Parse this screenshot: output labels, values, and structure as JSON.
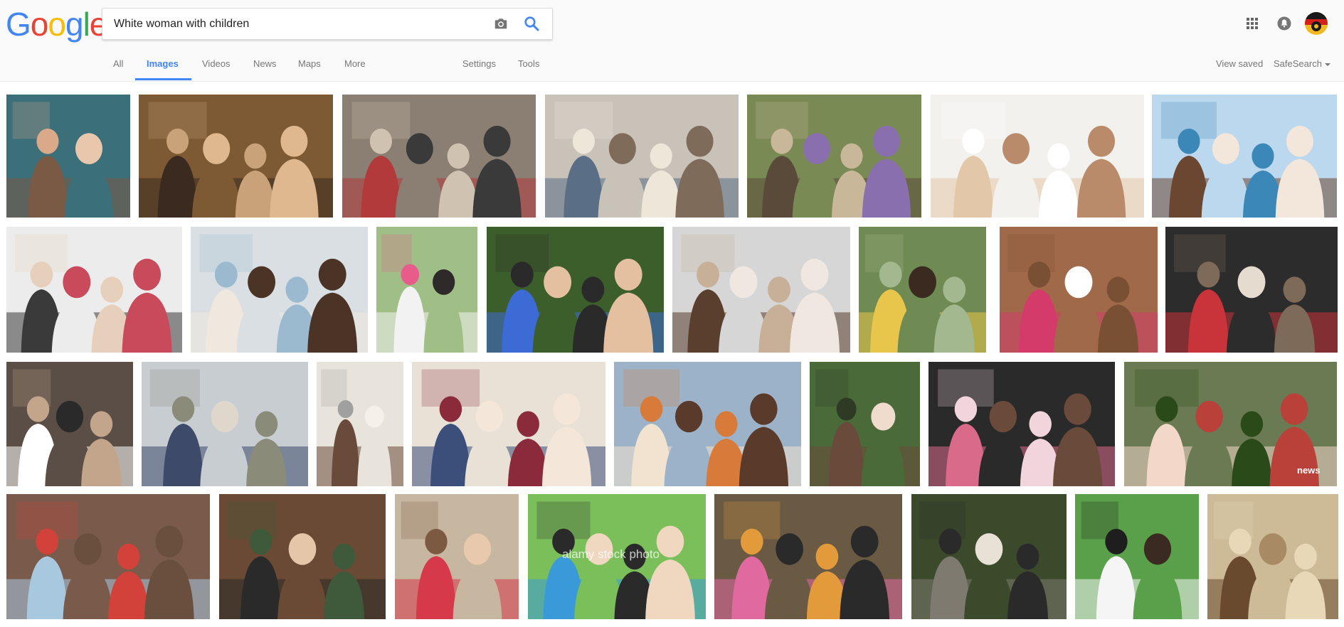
{
  "header": {
    "logo_letters": [
      {
        "char": "G",
        "color": "#4285f4"
      },
      {
        "char": "o",
        "color": "#ea4335"
      },
      {
        "char": "o",
        "color": "#fbbc05"
      },
      {
        "char": "g",
        "color": "#4285f4"
      },
      {
        "char": "l",
        "color": "#34a853"
      },
      {
        "char": "e",
        "color": "#ea4335"
      }
    ],
    "search_value": "White woman with children",
    "camera_icon": "camera-icon",
    "search_icon": "search-icon",
    "apps_icon": "apps-grid-icon",
    "notifications_icon": "bell-icon"
  },
  "tabs": {
    "all": "All",
    "images": "Images",
    "videos": "Videos",
    "news": "News",
    "maps": "Maps",
    "more": "More",
    "settings": "Settings",
    "tools": "Tools",
    "active": "Images"
  },
  "right_links": {
    "view_saved": "View saved",
    "safesearch": "SafeSearch"
  },
  "watermarks": {
    "alamy": "alamy stock photo",
    "news": "news"
  },
  "accent_color": "#4285f4"
}
